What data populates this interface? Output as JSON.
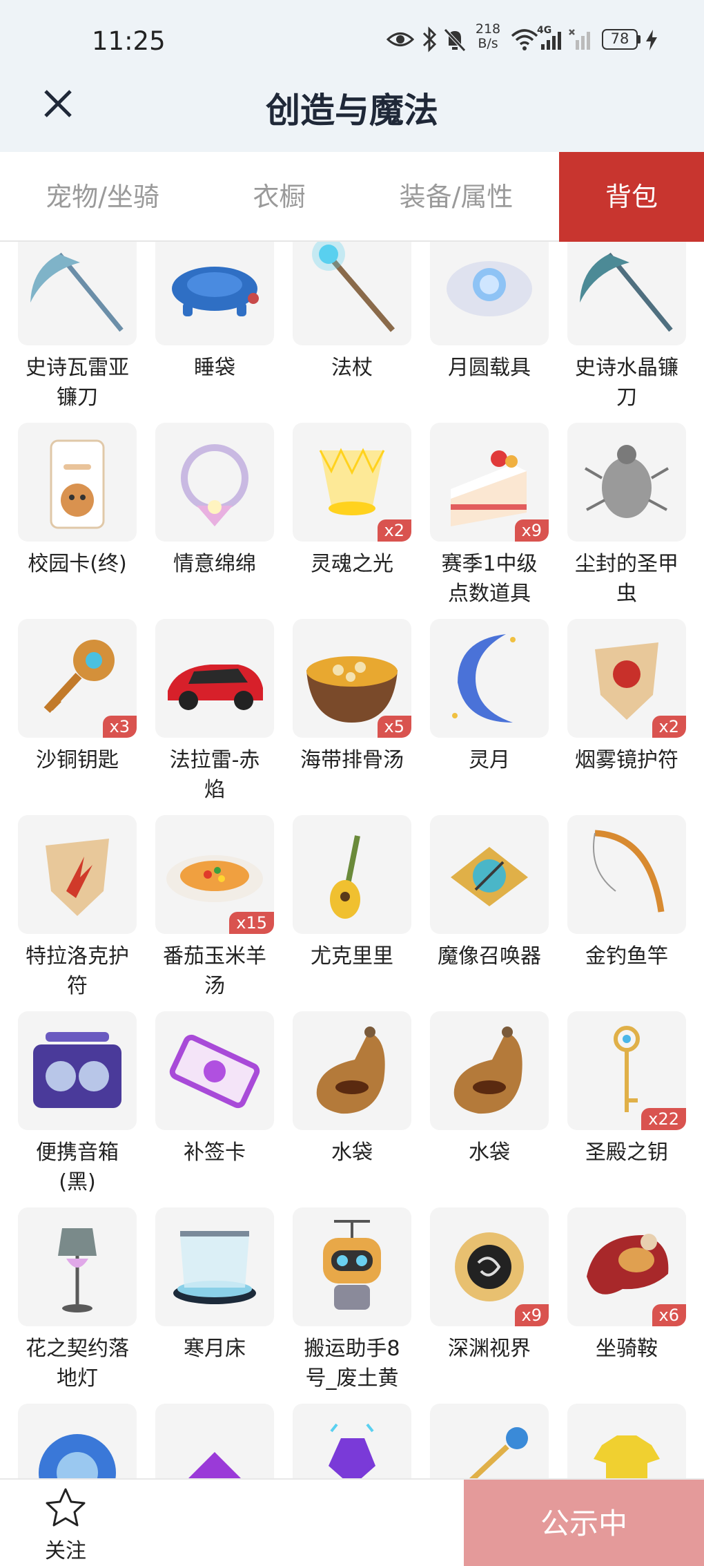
{
  "status_bar": {
    "time": "11:25",
    "network_speed_value": "218",
    "network_speed_unit": "B/s",
    "signal_label": "4G",
    "battery": "78",
    "icons": [
      "eye-icon",
      "bluetooth-icon",
      "mute-bell-icon",
      "wifi-icon",
      "signal-icon",
      "signal-off-icon",
      "battery-icon",
      "charging-icon"
    ]
  },
  "header": {
    "title": "创造与魔法",
    "close_icon": "close-icon"
  },
  "tabs": [
    {
      "label": "宠物/坐骑",
      "active": false
    },
    {
      "label": "衣橱",
      "active": false
    },
    {
      "label": "装备/属性",
      "active": false
    },
    {
      "label": "背包",
      "active": true
    }
  ],
  "items": [
    {
      "name": "史诗瓦雷亚镰刀",
      "line1": "史诗瓦雷亚",
      "line2": "镰刀",
      "qty": "",
      "icon": "scythe-icon"
    },
    {
      "name": "睡袋",
      "line1": "睡袋",
      "line2": "",
      "qty": "",
      "icon": "sleeping-bag-icon"
    },
    {
      "name": "法杖",
      "line1": "法杖",
      "line2": "",
      "qty": "",
      "icon": "staff-icon"
    },
    {
      "name": "月圆载具",
      "line1": "月圆载具",
      "line2": "",
      "qty": "",
      "icon": "moon-vehicle-icon"
    },
    {
      "name": "史诗水晶镰刀",
      "line1": "史诗水晶镰",
      "line2": "刀",
      "qty": "",
      "icon": "crystal-scythe-icon"
    },
    {
      "name": "校园卡(终)",
      "line1": "校园卡(终)",
      "line2": "",
      "qty": "",
      "icon": "campus-card-icon"
    },
    {
      "name": "情意绵绵",
      "line1": "情意绵绵",
      "line2": "",
      "qty": "",
      "icon": "wreath-icon"
    },
    {
      "name": "灵魂之光",
      "line1": "灵魂之光",
      "line2": "",
      "qty": "x2",
      "icon": "soul-light-icon"
    },
    {
      "name": "赛季1中级点数道具",
      "line1": "赛季1中级",
      "line2": "点数道具",
      "qty": "x9",
      "icon": "cake-icon"
    },
    {
      "name": "尘封的圣甲虫",
      "line1": "尘封的圣甲",
      "line2": "虫",
      "qty": "",
      "icon": "beetle-icon"
    },
    {
      "name": "沙铜钥匙",
      "line1": "沙铜钥匙",
      "line2": "",
      "qty": "x3",
      "icon": "bronze-key-icon"
    },
    {
      "name": "法拉雷-赤焰",
      "line1": "法拉雷-赤",
      "line2": "焰",
      "qty": "",
      "icon": "red-car-icon"
    },
    {
      "name": "海带排骨汤",
      "line1": "海带排骨汤",
      "line2": "",
      "qty": "x5",
      "icon": "soup-bowl-icon"
    },
    {
      "name": "灵月",
      "line1": "灵月",
      "line2": "",
      "qty": "",
      "icon": "crescent-moon-icon"
    },
    {
      "name": "烟雾镜护符",
      "line1": "烟雾镜护符",
      "line2": "",
      "qty": "x2",
      "icon": "red-amulet-icon"
    },
    {
      "name": "特拉洛克护符",
      "line1": "特拉洛克护",
      "line2": "符",
      "qty": "",
      "icon": "tlaloc-amulet-icon"
    },
    {
      "name": "番茄玉米羊汤",
      "line1": "番茄玉米羊",
      "line2": "汤",
      "qty": "x15",
      "icon": "tomato-soup-icon"
    },
    {
      "name": "尤克里里",
      "line1": "尤克里里",
      "line2": "",
      "qty": "",
      "icon": "ukulele-icon"
    },
    {
      "name": "魔像召唤器",
      "line1": "魔像召唤器",
      "line2": "",
      "qty": "",
      "icon": "golem-summoner-icon"
    },
    {
      "name": "金钓鱼竿",
      "line1": "金钓鱼竿",
      "line2": "",
      "qty": "",
      "icon": "fishing-rod-icon"
    },
    {
      "name": "便携音箱(黑)",
      "line1": "便携音箱",
      "line2": "(黑)",
      "qty": "",
      "icon": "speaker-icon"
    },
    {
      "name": "补签卡",
      "line1": "补签卡",
      "line2": "",
      "qty": "",
      "icon": "ticket-icon"
    },
    {
      "name": "水袋",
      "line1": "水袋",
      "line2": "",
      "qty": "",
      "icon": "water-bag-icon"
    },
    {
      "name": "水袋",
      "line1": "水袋",
      "line2": "",
      "qty": "",
      "icon": "water-bag-icon"
    },
    {
      "name": "圣殿之钥",
      "line1": "圣殿之钥",
      "line2": "",
      "qty": "x22",
      "icon": "temple-key-icon"
    },
    {
      "name": "花之契约落地灯",
      "line1": "花之契约落",
      "line2": "地灯",
      "qty": "",
      "icon": "floor-lamp-icon"
    },
    {
      "name": "寒月床",
      "line1": "寒月床",
      "line2": "",
      "qty": "",
      "icon": "moon-bed-icon"
    },
    {
      "name": "搬运助手8号_废土黄",
      "line1": "搬运助手8",
      "line2": "号_废土黄",
      "qty": "",
      "icon": "robot-icon"
    },
    {
      "name": "深渊视界",
      "line1": "深渊视界",
      "line2": "",
      "qty": "x9",
      "icon": "abyss-sun-icon"
    },
    {
      "name": "坐骑鞍",
      "line1": "坐骑鞍",
      "line2": "",
      "qty": "x6",
      "icon": "saddle-icon"
    },
    {
      "name": "",
      "line1": "",
      "line2": "",
      "qty": "",
      "icon": "blue-gear-icon"
    },
    {
      "name": "",
      "line1": "",
      "line2": "",
      "qty": "",
      "icon": "purple-crystal-icon"
    },
    {
      "name": "",
      "line1": "",
      "line2": "",
      "qty": "",
      "icon": "purple-gem-icon"
    },
    {
      "name": "",
      "line1": "",
      "line2": "",
      "qty": "",
      "icon": "blue-key-icon"
    },
    {
      "name": "",
      "line1": "",
      "line2": "",
      "qty": "",
      "icon": "yellow-shirt-icon"
    }
  ],
  "bottom_bar": {
    "follow_label": "关注",
    "follow_icon": "star-icon",
    "public_label": "公示中"
  },
  "colors": {
    "accent": "#c8352f",
    "public_button": "#e49a9a",
    "qty_badge": "#d9534f",
    "header_bg": "#eef3f7"
  }
}
